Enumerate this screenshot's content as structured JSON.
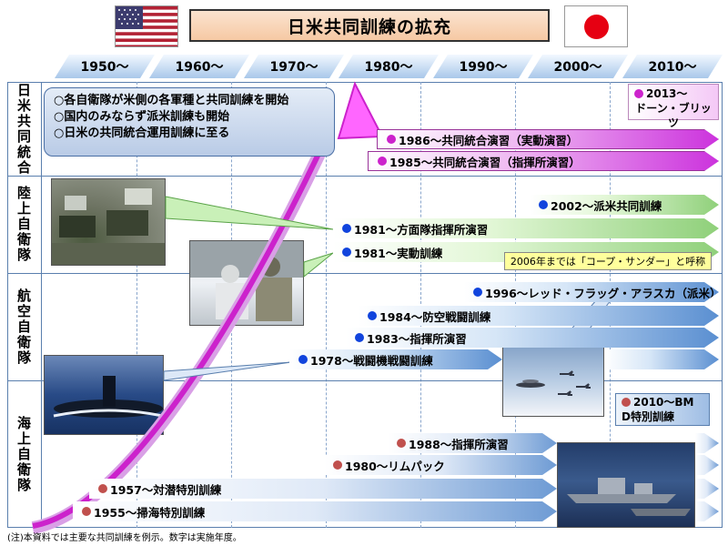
{
  "title": "日米共同訓練の拡充",
  "decades": [
    "1950～",
    "1960～",
    "1970～",
    "1980～",
    "1990～",
    "2000～",
    "2010～"
  ],
  "rows": {
    "joint": "日米共同統合",
    "gsdf": "陸上自衛隊",
    "asdf": "航空自衛隊",
    "msdf": "海上自衛隊"
  },
  "callout": [
    "○各自衛隊が米側の各軍種と共同訓練を開始",
    "○国内のみならず派米訓練も開始",
    "○日米の共同統合運用訓練に至る"
  ],
  "trainings": {
    "t2013_line1": "2013～",
    "t2013_line2": "ドーン・ブリッツ",
    "t1986": "1986～共同統合演習（実動演習）",
    "t1985": "1985～共同統合演習（指揮所演習）",
    "t2002": "2002～派米共同訓練",
    "t1981a": "1981～方面隊指揮所演習",
    "t1981b": "1981～実動訓練",
    "t1996": "1996～レッド・フラッグ・アラスカ（派米）",
    "t1984": "1984～防空戦闘訓練",
    "t1983": "1983～指揮所演習",
    "t1978": "1978～戦闘機戦闘訓練",
    "t2010_line1": "2010～BM",
    "t2010_line2": "D特別訓練",
    "t1988": "1988～指揮所演習",
    "t1980": "1980～リムパック",
    "t1957": "1957～対潜特別訓練",
    "t1955": "1955～掃海特別訓練"
  },
  "note": "2006年までは「コープ・サンダー」と呼称",
  "footnote": "(注)本資料では主要な共同訓練を例示。数字は実施年度。",
  "icons": {
    "flag_us": "us-flag-icon",
    "flag_jp": "japan-flag-icon"
  },
  "colors": {
    "joint": "#cc33dd",
    "gsdf": "#8fd07a",
    "asdf": "#5a8fd1",
    "msdf": "#6e9bd4",
    "growth_arrow": "#cc22cc"
  }
}
